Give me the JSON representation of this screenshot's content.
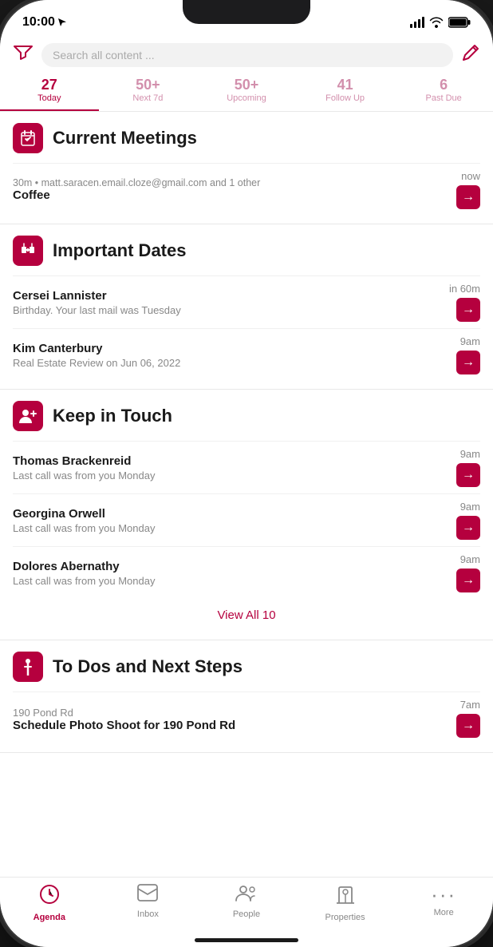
{
  "status": {
    "time": "10:00",
    "location_arrow": "▶"
  },
  "search": {
    "placeholder": "Search all content ..."
  },
  "tabs": [
    {
      "count": "27",
      "label": "Today",
      "active": true
    },
    {
      "count": "50+",
      "label": "Next 7d",
      "active": false
    },
    {
      "count": "50+",
      "label": "Upcoming",
      "active": false
    },
    {
      "count": "41",
      "label": "Follow Up",
      "active": false
    },
    {
      "count": "6",
      "label": "Past Due",
      "active": false
    }
  ],
  "sections": {
    "current_meetings": {
      "title": "Current Meetings",
      "items": [
        {
          "sub": "30m • matt.saracen.email.cloze@gmail.com and 1 other",
          "name": "Coffee",
          "time": "now"
        }
      ]
    },
    "important_dates": {
      "title": "Important Dates",
      "items": [
        {
          "name": "Cersei Lannister",
          "sub": "Birthday. Your last mail was Tuesday",
          "time": "in 60m"
        },
        {
          "name": "Kim Canterbury",
          "sub": "Real Estate Review on Jun 06, 2022",
          "time": "9am"
        }
      ]
    },
    "keep_in_touch": {
      "title": "Keep in Touch",
      "items": [
        {
          "name": "Thomas Brackenreid",
          "sub": "Last call was from you Monday",
          "time": "9am"
        },
        {
          "name": "Georgina Orwell",
          "sub": "Last call was from you Monday",
          "time": "9am"
        },
        {
          "name": "Dolores Abernathy",
          "sub": "Last call was from you Monday",
          "time": "9am"
        }
      ],
      "view_all": "View All 10"
    },
    "todos": {
      "title": "To Dos and Next Steps",
      "items": [
        {
          "sub": "190 Pond Rd",
          "name": "Schedule Photo Shoot for 190 Pond Rd",
          "time": "7am"
        }
      ]
    }
  },
  "bottom_nav": [
    {
      "id": "agenda",
      "label": "Agenda",
      "icon": "🕐",
      "active": true
    },
    {
      "id": "inbox",
      "label": "Inbox",
      "icon": "✉",
      "active": false
    },
    {
      "id": "people",
      "label": "People",
      "icon": "👥",
      "active": false
    },
    {
      "id": "properties",
      "label": "Properties",
      "icon": "🏷",
      "active": false
    },
    {
      "id": "more",
      "label": "More",
      "icon": "···",
      "active": false
    }
  ],
  "accent": "#b5003e"
}
